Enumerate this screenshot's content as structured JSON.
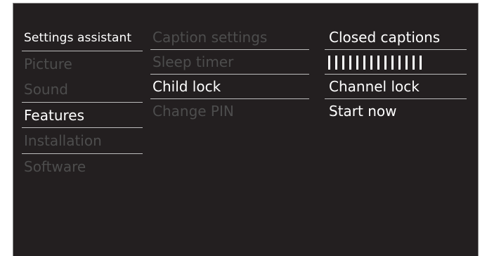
{
  "menu": {
    "categories": [
      {
        "label": "Settings assistant",
        "state": "normal"
      },
      {
        "label": "Picture",
        "state": "dim"
      },
      {
        "label": "Sound",
        "state": "dim"
      },
      {
        "label": "Features",
        "state": "selected"
      },
      {
        "label": "Installation",
        "state": "dim"
      },
      {
        "label": "Software",
        "state": "dim"
      }
    ],
    "features": [
      {
        "label": "Caption settings",
        "state": "dim"
      },
      {
        "label": "Sleep timer",
        "state": "dim"
      },
      {
        "label": "Child lock",
        "state": "selected"
      },
      {
        "label": "Change PIN",
        "state": "dim"
      }
    ],
    "child_lock": {
      "items": [
        {
          "label": "Closed captions"
        },
        {
          "label": "Channel lock"
        },
        {
          "label": "Start now"
        }
      ],
      "pin_entry": {
        "bar_count": 14
      }
    }
  },
  "colors": {
    "background": "#231f20",
    "text_bright": "#ffffff",
    "text_dim": "#4d4d4d",
    "separator": "#bdbdbd"
  }
}
